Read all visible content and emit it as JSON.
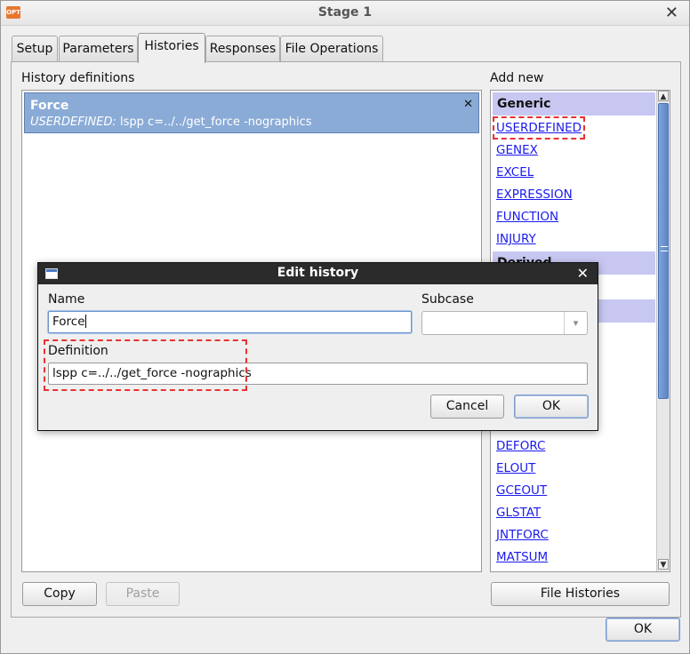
{
  "window": {
    "title": "Stage 1",
    "app_icon_text": "OPT"
  },
  "tabs": [
    {
      "label": "Setup"
    },
    {
      "label": "Parameters"
    },
    {
      "label": "Histories"
    },
    {
      "label": "Responses"
    },
    {
      "label": "File Operations"
    }
  ],
  "active_tab": "Histories",
  "history_definitions": {
    "heading": "History definitions",
    "items": [
      {
        "name": "Force",
        "type": "USERDEFINED:",
        "command": "lspp c=../../get_force -nographics"
      }
    ]
  },
  "add_new": {
    "heading": "Add new",
    "groups": [
      {
        "header": "Generic",
        "items": [
          "USERDEFINED",
          "GENEX",
          "EXCEL",
          "EXPRESSION",
          "FUNCTION",
          "INJURY"
        ]
      },
      {
        "header": "Derived"
      }
    ],
    "more_items": [
      "DEFORC",
      "ELOUT",
      "GCEOUT",
      "GLSTAT",
      "JNTFORC",
      "MATSUM"
    ]
  },
  "buttons": {
    "copy": "Copy",
    "paste": "Paste",
    "file_histories": "File Histories",
    "ok": "OK"
  },
  "dialog": {
    "title": "Edit history",
    "name_label": "Name",
    "name_value": "Force",
    "subcase_label": "Subcase",
    "subcase_value": "",
    "definition_label": "Definition",
    "definition_value": "lspp c=../../get_force -nographics",
    "cancel_label": "Cancel",
    "ok_label": "OK"
  },
  "colors": {
    "selection": "#8aabd6",
    "group_header": "#c7c7f2",
    "link": "#1a1aee",
    "highlight_dashed": "#e83131",
    "dialog_titlebar": "#2b2b2b"
  }
}
